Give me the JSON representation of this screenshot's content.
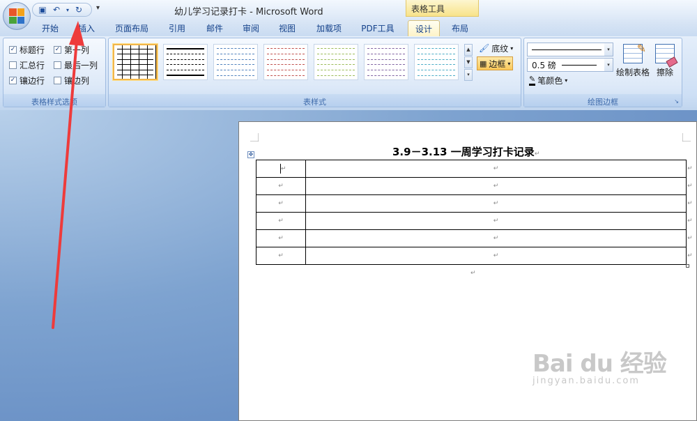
{
  "window": {
    "title": "幼儿学习记录打卡 - Microsoft Word",
    "contextual_tool_header": "表格工具",
    "office_button_icon": "office-logo-icon",
    "quick_access": {
      "icons": [
        "save-icon",
        "undo-icon",
        "dropdown-icon",
        "redo-icon"
      ],
      "more_glyph": "▾"
    }
  },
  "tabs": [
    {
      "label": "开始",
      "active": false
    },
    {
      "label": "插入",
      "active": false
    },
    {
      "label": "页面布局",
      "active": false
    },
    {
      "label": "引用",
      "active": false
    },
    {
      "label": "邮件",
      "active": false
    },
    {
      "label": "审阅",
      "active": false
    },
    {
      "label": "视图",
      "active": false
    },
    {
      "label": "加载项",
      "active": false
    },
    {
      "label": "PDF工具",
      "active": false
    },
    {
      "label": "设计",
      "active": true
    },
    {
      "label": "布局",
      "active": false
    }
  ],
  "ribbon": {
    "table_style_options": {
      "label": "表格样式选项",
      "options": [
        {
          "label": "标题行",
          "checked": true
        },
        {
          "label": "第一列",
          "checked": true
        },
        {
          "label": "汇总行",
          "checked": false
        },
        {
          "label": "最后一列",
          "checked": false
        },
        {
          "label": "镶边行",
          "checked": true
        },
        {
          "label": "镶边列",
          "checked": false
        }
      ]
    },
    "table_styles": {
      "label": "表样式",
      "thumbnails": [
        {
          "color": "#000000",
          "selected": true
        },
        {
          "color": "#000000",
          "selected": false
        },
        {
          "color": "#4f81bd",
          "selected": false
        },
        {
          "color": "#c0504d",
          "selected": false
        },
        {
          "color": "#9bbb59",
          "selected": false
        },
        {
          "color": "#8064a2",
          "selected": false
        },
        {
          "color": "#4bacc6",
          "selected": false
        }
      ],
      "shading_label": "底纹",
      "borders_label": "边框"
    },
    "draw_borders": {
      "label": "绘图边框",
      "weight_value": "0.5 磅",
      "pen_color_label": "笔颜色",
      "draw_table_label": "绘制表格",
      "eraser_label": "擦除"
    }
  },
  "document": {
    "heading": "3.9－3.13 一周学习打卡记录",
    "paragraph_mark": "↵",
    "table_rows": 6
  },
  "watermark": {
    "main": "Bai du 经验",
    "sub": "jingyan.baidu.com"
  },
  "colors": {
    "active_tab": "#fdf3c6",
    "annotation_arrow": "#ee3b3b",
    "ribbon_label": "#3e6aaa"
  }
}
